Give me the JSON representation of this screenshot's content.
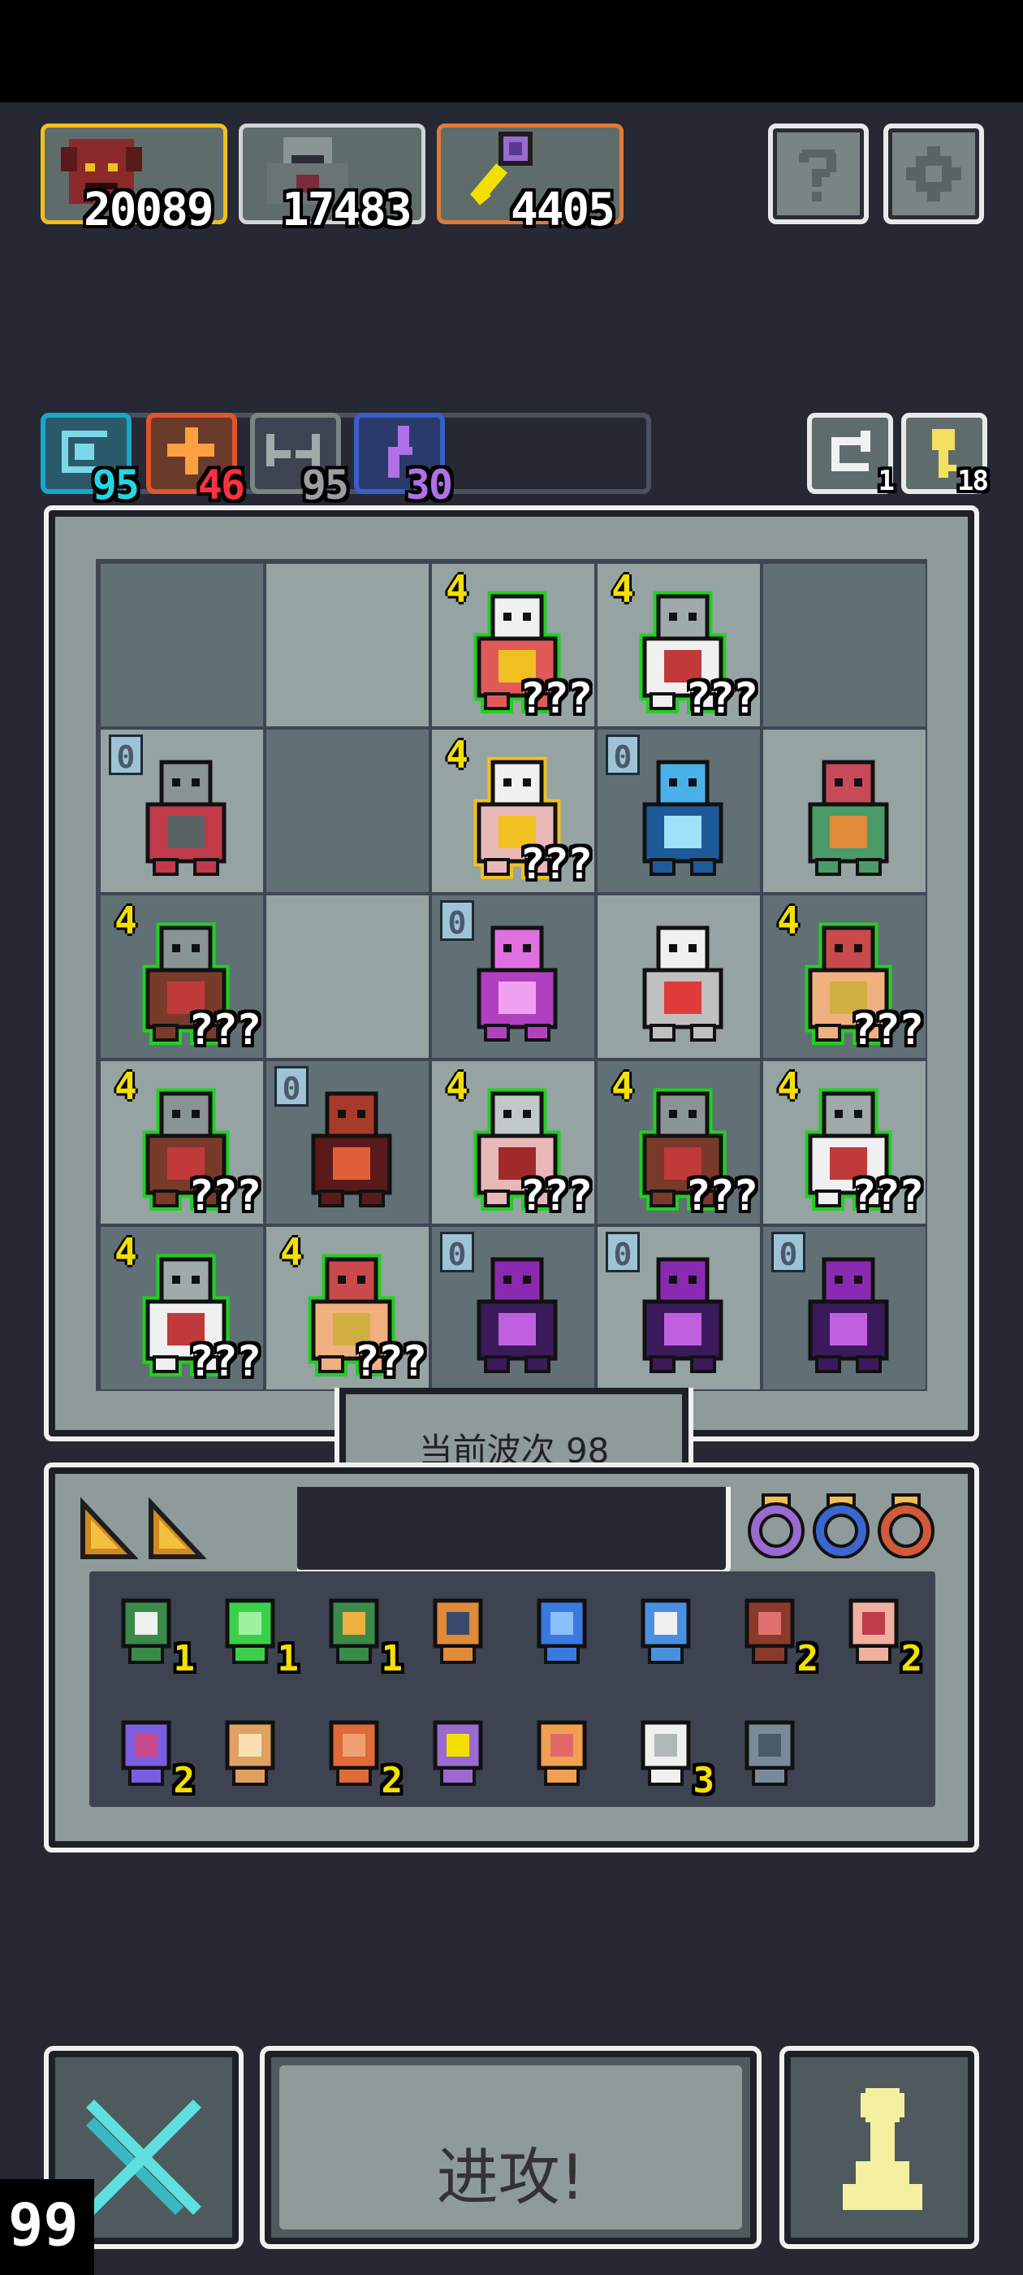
{
  "resources": [
    {
      "name": "red-demon",
      "value": "20089",
      "border": "#f0c020"
    },
    {
      "name": "grey-knight",
      "value": "17483",
      "border": "#cfd5d5"
    },
    {
      "name": "staff",
      "value": "4405",
      "border": "#e07a3a"
    }
  ],
  "stats": [
    {
      "name": "spiral",
      "value": "95",
      "color": "#1aa6c8",
      "val_color": "#24d6e0"
    },
    {
      "name": "cross",
      "value": "46",
      "color": "#e0552a",
      "val_color": "#ff3040"
    },
    {
      "name": "wings",
      "value": "95",
      "color": "#7a8484",
      "val_color": "#9aa0a0"
    },
    {
      "name": "bolt",
      "value": "30",
      "color": "#3a5ec8",
      "val_color": "#b070e8"
    }
  ],
  "counters": {
    "cycle": "1",
    "key": "18"
  },
  "board": {
    "hidden_text": "???",
    "cells": [
      {
        "shade": "dark",
        "level": "",
        "unit": ""
      },
      {
        "shade": "light",
        "level": "",
        "unit": ""
      },
      {
        "shade": "light",
        "level": "4",
        "unit": "priestess",
        "hidden": true
      },
      {
        "shade": "light",
        "level": "4",
        "unit": "knight-white",
        "hidden": true
      },
      {
        "shade": "dark",
        "level": "",
        "unit": ""
      },
      {
        "shade": "light",
        "level": "0",
        "unit": "bone-golem",
        "hidden": false
      },
      {
        "shade": "dark",
        "level": "",
        "unit": ""
      },
      {
        "shade": "light",
        "level": "4",
        "unit": "saintess",
        "hidden": true
      },
      {
        "shade": "dark",
        "level": "0",
        "unit": "ice-demon",
        "hidden": false
      },
      {
        "shade": "light",
        "level": "",
        "unit": "crystal"
      },
      {
        "shade": "dark",
        "level": "4",
        "unit": "shield-knight",
        "hidden": true
      },
      {
        "shade": "light",
        "level": "",
        "unit": ""
      },
      {
        "shade": "dark",
        "level": "0",
        "unit": "pink-demon",
        "hidden": false
      },
      {
        "shade": "light",
        "level": "",
        "unit": "white-beast"
      },
      {
        "shade": "dark",
        "level": "4",
        "unit": "barbarian",
        "hidden": true
      },
      {
        "shade": "light",
        "level": "4",
        "unit": "shield-knight",
        "hidden": true
      },
      {
        "shade": "dark",
        "level": "0",
        "unit": "red-dragon",
        "hidden": false
      },
      {
        "shade": "light",
        "level": "4",
        "unit": "silver-maiden",
        "hidden": true
      },
      {
        "shade": "dark",
        "level": "4",
        "unit": "shield-knight",
        "hidden": true
      },
      {
        "shade": "light",
        "level": "4",
        "unit": "knight-white",
        "hidden": true
      },
      {
        "shade": "dark",
        "level": "4",
        "unit": "knight-white",
        "hidden": true
      },
      {
        "shade": "light",
        "level": "4",
        "unit": "barbarian",
        "hidden": true
      },
      {
        "shade": "dark",
        "level": "0",
        "unit": "purple-dragon",
        "hidden": false
      },
      {
        "shade": "light",
        "level": "0",
        "unit": "purple-dragon",
        "hidden": false
      },
      {
        "shade": "dark",
        "level": "0",
        "unit": "purple-dragon",
        "hidden": false
      }
    ]
  },
  "wave": {
    "label": "当前波次 98"
  },
  "inventory": {
    "tabs": [
      "gold-triangle",
      "gold-triangle"
    ],
    "rings": [
      {
        "color": "#9a6ad0"
      },
      {
        "color": "#3a66d0"
      },
      {
        "color": "#d05a3a"
      }
    ],
    "items": [
      {
        "icon": "green-hood-icon",
        "count": "1"
      },
      {
        "icon": "emerald-icon",
        "count": "1"
      },
      {
        "icon": "green-hood-gold-icon",
        "count": "1"
      },
      {
        "icon": "flame-staff-icon",
        "count": ""
      },
      {
        "icon": "blue-swirl-icon",
        "count": ""
      },
      {
        "icon": "ice-dagger-icon",
        "count": ""
      },
      {
        "icon": "brown-beast-icon",
        "count": "2"
      },
      {
        "icon": "eye-hand-icon",
        "count": "2"
      },
      {
        "icon": "potion-icon",
        "count": "2"
      },
      {
        "icon": "trident-icon",
        "count": ""
      },
      {
        "icon": "fire-axe-icon",
        "count": "2"
      },
      {
        "icon": "purple-staff-icon",
        "count": ""
      },
      {
        "icon": "fire-orb-icon",
        "count": ""
      },
      {
        "icon": "white-wings-icon",
        "count": "3"
      },
      {
        "icon": "lever-icon",
        "count": ""
      }
    ]
  },
  "controls": {
    "attack_label": "进攻!"
  },
  "corner": {
    "value": "99"
  }
}
